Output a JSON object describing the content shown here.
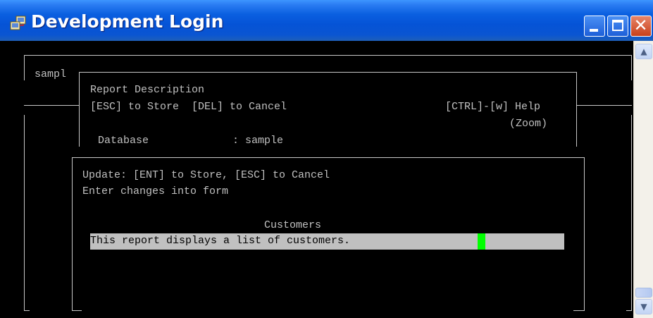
{
  "window": {
    "title": "Development Login",
    "icon": "app-icon",
    "buttons": [
      "minimize",
      "maximize",
      "close"
    ]
  },
  "background_form": {
    "label": "sampl"
  },
  "report_panel": {
    "title": "Report Description",
    "store_hint": "[ESC] to Store  [DEL] to Cancel",
    "help_hint": "[CTRL]-[w] Help",
    "zoom_hint": "(Zoom)",
    "database_label": "Database",
    "database_value": ": sample"
  },
  "update_dialog": {
    "instruction": "Update: [ENT] to Store, [ESC] to Cancel",
    "subinstruction": "Enter changes into form",
    "field_label": "Customers",
    "field_value": "This report displays a list of customers."
  },
  "colors": {
    "terminal_bg": "#000000",
    "terminal_text": "#c0c0c0",
    "field_bg": "#c0c0c0",
    "cursor": "#00ff00",
    "titlebar": "#0a5fe0"
  }
}
